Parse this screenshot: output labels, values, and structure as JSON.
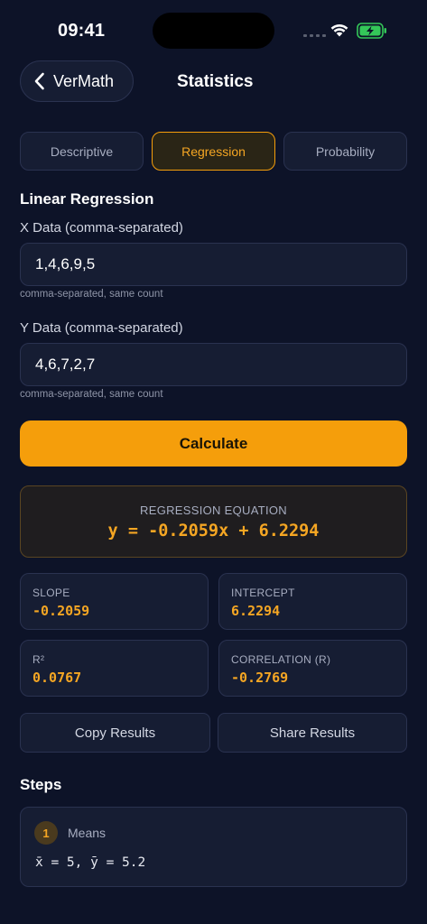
{
  "status_bar": {
    "time": "09:41"
  },
  "nav": {
    "back_label": "VerMath",
    "title": "Statistics"
  },
  "tabs": [
    {
      "label": "Descriptive",
      "active": false
    },
    {
      "label": "Regression",
      "active": true
    },
    {
      "label": "Probability",
      "active": false
    }
  ],
  "section": {
    "title": "Linear Regression"
  },
  "x_field": {
    "label": "X Data (comma-separated)",
    "value": "1,4,6,9,5",
    "hint": "comma-separated, same count"
  },
  "y_field": {
    "label": "Y Data (comma-separated)",
    "value": "4,6,7,2,7",
    "hint": "comma-separated, same count"
  },
  "calculate_label": "Calculate",
  "equation": {
    "label": "REGRESSION EQUATION",
    "value": "y = -0.2059x + 6.2294"
  },
  "stats": {
    "slope": {
      "label": "SLOPE",
      "value": "-0.2059"
    },
    "intercept": {
      "label": "INTERCEPT",
      "value": "6.2294"
    },
    "r2": {
      "label": "R²",
      "value": "0.0767"
    },
    "correlation": {
      "label": "CORRELATION (R)",
      "value": "-0.2769"
    }
  },
  "actions": {
    "copy_label": "Copy Results",
    "share_label": "Share Results"
  },
  "steps": {
    "title": "Steps",
    "items": [
      {
        "number": "1",
        "title": "Means",
        "expression": "x̄ = 5, ȳ = 5.2"
      }
    ]
  },
  "colors": {
    "background": "#0d1328",
    "accent": "#f59e0b",
    "card": "#161d33",
    "battery": "#34c759"
  }
}
